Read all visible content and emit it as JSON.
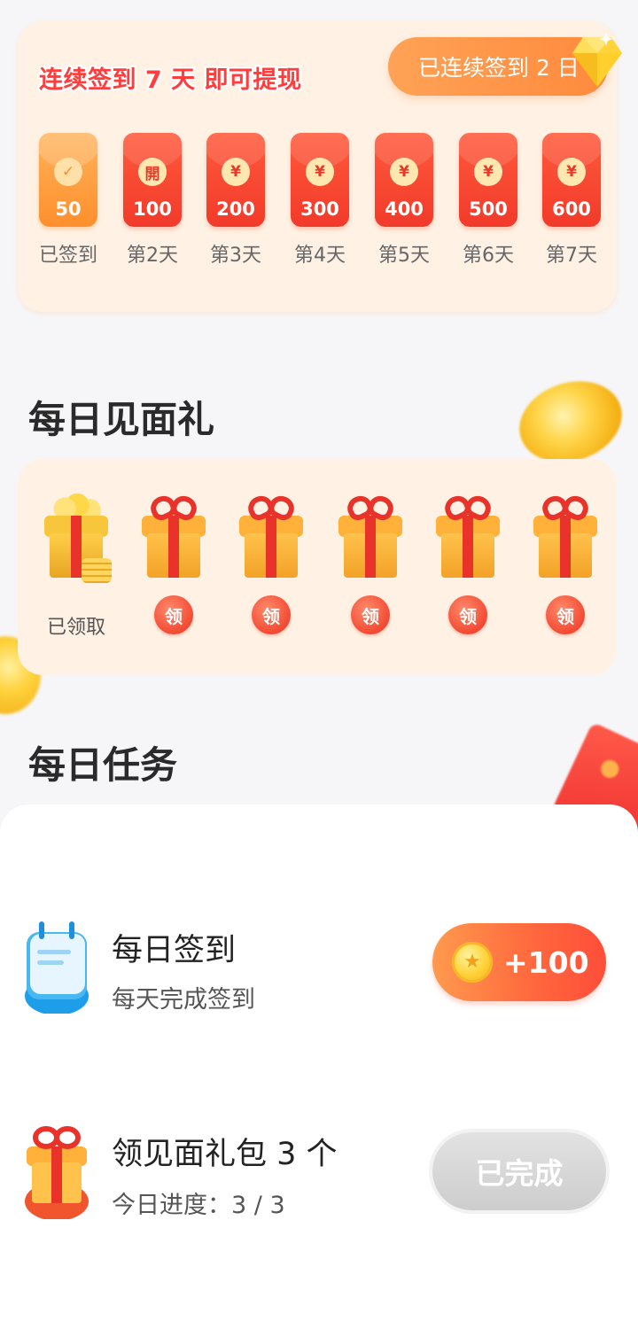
{
  "signin": {
    "title": "连续签到 7 天 即可提现",
    "streak_text": "已连续签到 2 日",
    "days": [
      {
        "amount": "50",
        "label": "已签到",
        "badge": "✓",
        "status": "done"
      },
      {
        "amount": "100",
        "label": "第2天",
        "badge": "開",
        "status": "open"
      },
      {
        "amount": "200",
        "label": "第3天",
        "badge": "¥",
        "status": "locked"
      },
      {
        "amount": "300",
        "label": "第4天",
        "badge": "¥",
        "status": "locked"
      },
      {
        "amount": "400",
        "label": "第5天",
        "badge": "¥",
        "status": "locked"
      },
      {
        "amount": "500",
        "label": "第6天",
        "badge": "¥",
        "status": "locked"
      },
      {
        "amount": "600",
        "label": "第7天",
        "badge": "¥",
        "status": "locked"
      }
    ]
  },
  "gifts": {
    "title": "每日见面礼",
    "claimed_label": "已领取",
    "claim_label": "领",
    "count": 6,
    "claimed_count": 1
  },
  "tasks": {
    "title": "每日任务",
    "items": [
      {
        "title": "每日签到",
        "subtitle": "每天完成签到",
        "action": "+100",
        "action_type": "reward",
        "icon": "calendar-icon"
      },
      {
        "title": "领见面礼包 3 个",
        "subtitle": "今日进度：3 / 3",
        "action": "已完成",
        "action_type": "done",
        "icon": "gift-icon"
      }
    ]
  },
  "colors": {
    "accent_red": "#f23a2a",
    "accent_orange": "#ff8a3d",
    "card_bg": "#fff1e3",
    "page_bg": "#f6f6f8"
  }
}
